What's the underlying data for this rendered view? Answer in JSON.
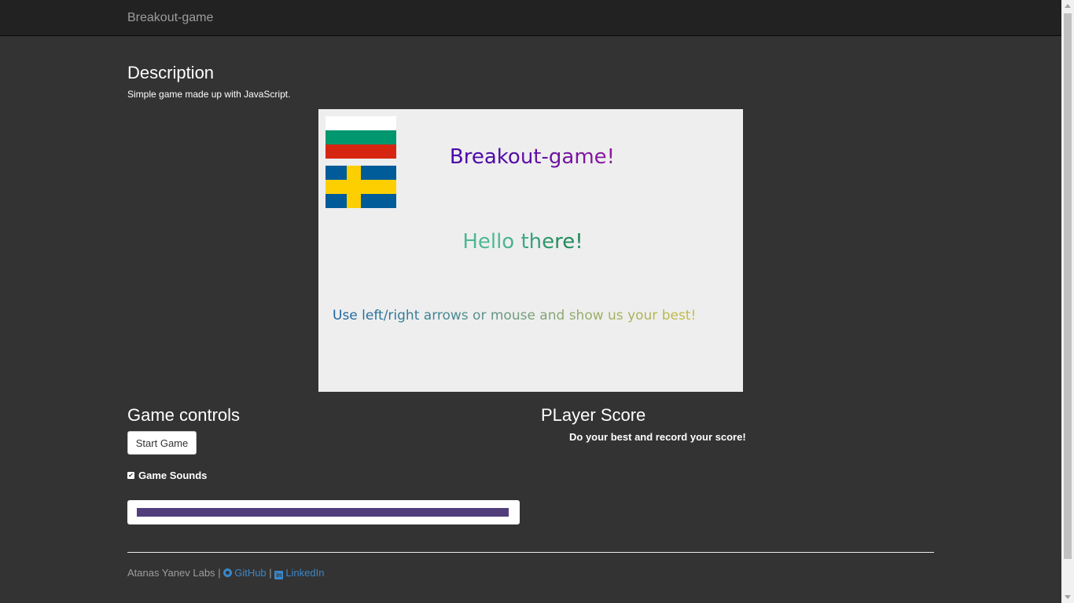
{
  "navbar": {
    "brand": "Breakout-game"
  },
  "description": {
    "title": "Description",
    "text": "Simple game made up with JavaScript."
  },
  "canvas": {
    "flags": [
      {
        "name": "bulgaria-flag",
        "colors": [
          "#ffffff",
          "#00966e",
          "#d62612"
        ]
      },
      {
        "name": "sweden-flag",
        "colors": [
          "#005b99",
          "#fdcf00"
        ]
      }
    ],
    "game_title": "Breakout-game!",
    "hello": "Hello there!",
    "instructions": "Use left/right arrows or mouse and show us your best!"
  },
  "controls": {
    "title": "Game controls",
    "start_button": "Start Game",
    "sound_label": "Game Sounds",
    "sound_checked": true,
    "progress_percent": 100,
    "progress_color": "#513e7b"
  },
  "score": {
    "title": "PLayer Score",
    "text": "Do your best and record your score!"
  },
  "footer": {
    "author": "Atanas Yanev Labs",
    "separator": "|",
    "github_label": "GitHub",
    "linkedin_label": "LinkedIn"
  }
}
